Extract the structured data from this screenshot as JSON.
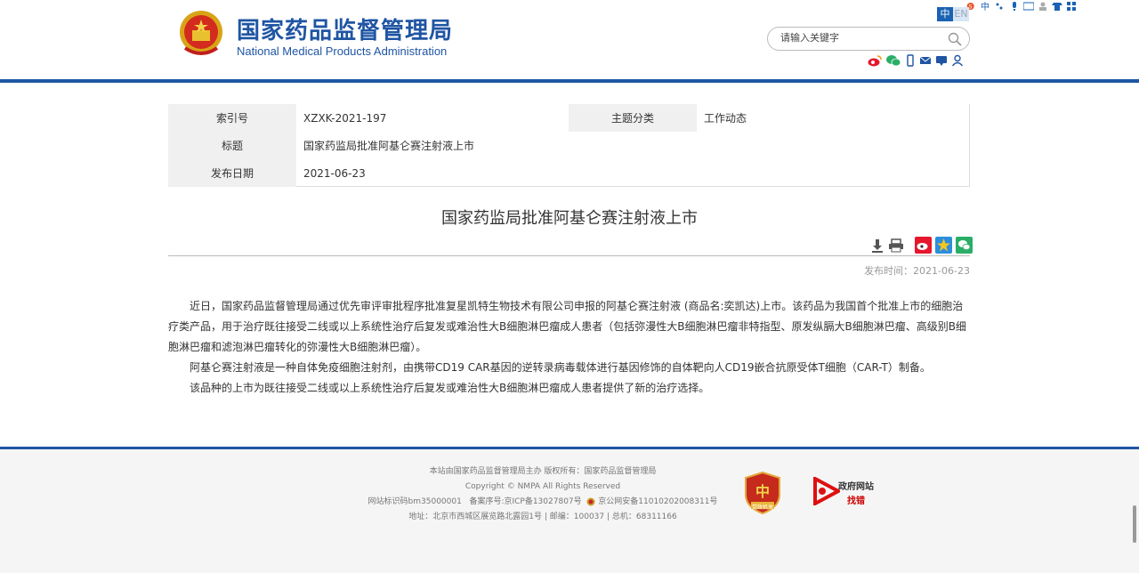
{
  "header": {
    "title_cn": "国家药品监督管理局",
    "title_en": "National Medical Products Administration",
    "lang_cn": "中",
    "lang_en": "EN",
    "search_placeholder": "请输入关键字"
  },
  "meta": {
    "index_label": "索引号",
    "index_value": "XZXK-2021-197",
    "category_label": "主题分类",
    "category_value": "工作动态",
    "title_label": "标题",
    "title_value": "国家药监局批准阿基仑赛注射液上市",
    "date_label": "发布日期",
    "date_value": "2021-06-23"
  },
  "article": {
    "title": "国家药监局批准阿基仑赛注射液上市",
    "pubtime": "发布时间：2021-06-23",
    "paragraphs": [
      "近日，国家药品监督管理局通过优先审评审批程序批准复星凯特生物技术有限公司申报的阿基仑赛注射液 (商品名:奕凯达)上市。该药品为我国首个批准上市的细胞治疗类产品，用于治疗既往接受二线或以上系统性治疗后复发或难治性大B细胞淋巴瘤成人患者（包括弥漫性大B细胞淋巴瘤非特指型、原发纵膈大B细胞淋巴瘤、高级别B细胞淋巴瘤和滤泡淋巴瘤转化的弥漫性大B细胞淋巴瘤）。",
      "阿基仑赛注射液是一种自体免疫细胞注射剂，由携带CD19 CAR基因的逆转录病毒载体进行基因修饰的自体靶向人CD19嵌合抗原受体T细胞（CAR-T）制备。",
      "该品种的上市为既往接受二线或以上系统性治疗后复发或难治性大B细胞淋巴瘤成人患者提供了新的治疗选择。"
    ]
  },
  "footer": {
    "line1": "本站由国家药品监督管理局主办 版权所有：国家药品监督管理局",
    "line2": "Copyright © NMPA All Rights Reserved",
    "line3a": "网站标识码bm35000001",
    "line3b": "备案序号:京ICP备13027807号",
    "line3c": "京公网安备11010202008311号",
    "line4": "地址：北京市西城区展览路北露园1号 | 邮编：100037 | 总机：68311166",
    "badge_left": "党政机关",
    "badge_right_1": "政府网站",
    "badge_right_2": "找错"
  },
  "icons": {
    "accent": "#1f55a3"
  }
}
